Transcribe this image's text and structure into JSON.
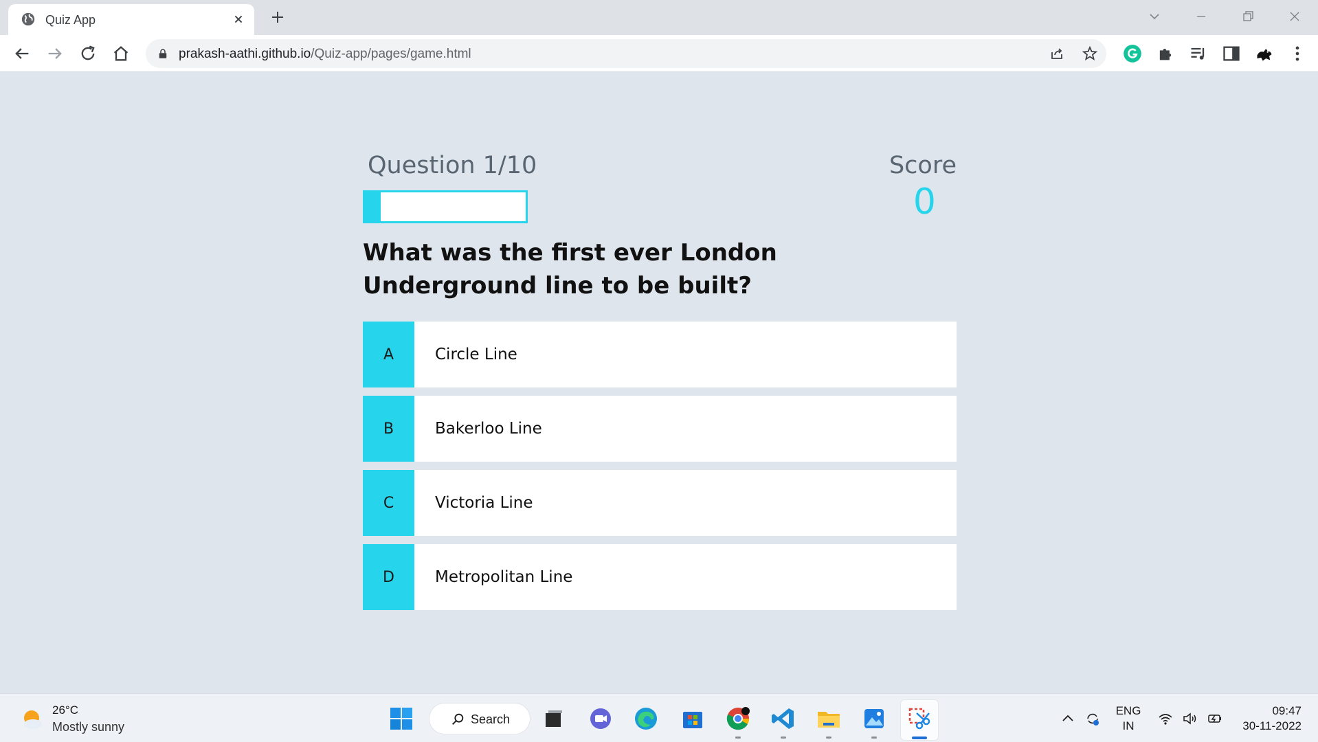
{
  "browser": {
    "tab_title": "Quiz App",
    "url_host": "prakash-aathi.github.io",
    "url_path": "/Quiz-app/pages/game.html"
  },
  "quiz": {
    "question_counter": "Question 1/10",
    "progress_fraction": 0.1,
    "score_label": "Score",
    "score_value": "0",
    "question": "What was the first ever London Underground line to be built?",
    "choices": [
      {
        "prefix": "A",
        "text": "Circle Line"
      },
      {
        "prefix": "B",
        "text": "Bakerloo Line"
      },
      {
        "prefix": "C",
        "text": "Victoria Line"
      },
      {
        "prefix": "D",
        "text": "Metropolitan Line"
      }
    ]
  },
  "taskbar": {
    "weather_temp": "26°C",
    "weather_desc": "Mostly sunny",
    "search_label": "Search",
    "lang_line1": "ENG",
    "lang_line2": "IN",
    "time": "09:47",
    "date": "30-11-2022"
  },
  "colors": {
    "accent": "#26d5eb",
    "page_bg": "#dfe5ed"
  }
}
